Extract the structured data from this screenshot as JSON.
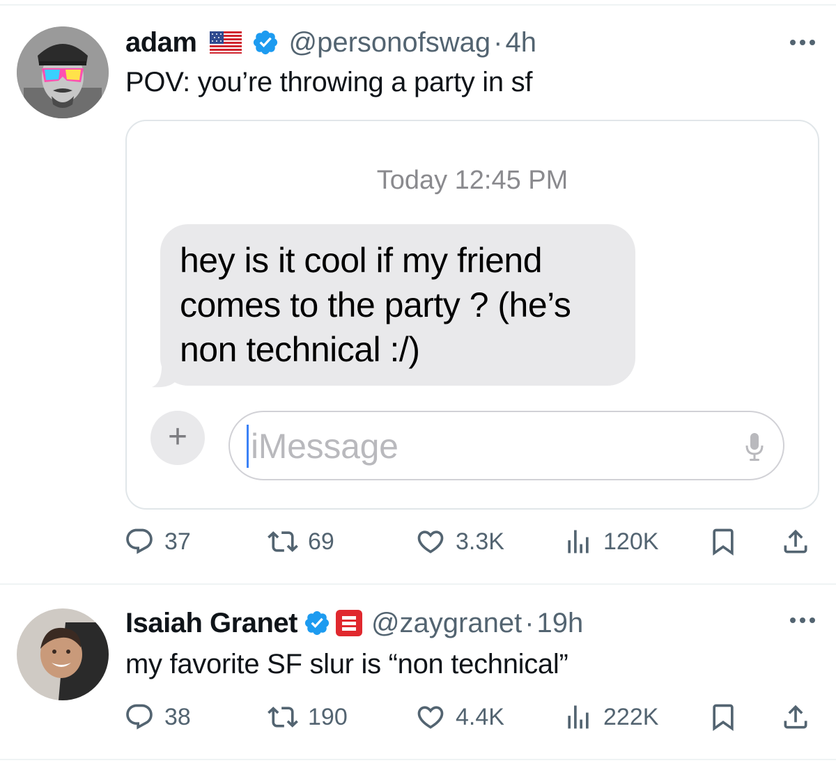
{
  "tweets": [
    {
      "display_name": "adam",
      "handle": "@personofswag",
      "separator": "·",
      "time": "4h",
      "text": "POV: you’re throwing a party in sf",
      "media": {
        "timestamp": "Today 12:45 PM",
        "bubble_text": "hey is it cool if my friend comes to the party ? (he’s non technical :/)",
        "input_placeholder": "iMessage",
        "plus_label": "+"
      },
      "stats": {
        "replies": "37",
        "retweets": "69",
        "likes": "3.3K",
        "views": "120K"
      }
    },
    {
      "display_name": "Isaiah Granet",
      "handle": "@zaygranet",
      "separator": "·",
      "time": "19h",
      "text": "my favorite SF slur is “non technical”",
      "stats": {
        "replies": "38",
        "retweets": "190",
        "likes": "4.4K",
        "views": "222K"
      }
    }
  ],
  "colors": {
    "verified_blue": "#1d9bf0",
    "secondary_text": "#536471",
    "bubble_gray": "#e9e9eb",
    "org_badge_red": "#e0282e"
  },
  "icons": {
    "reply": "speech-bubble-icon",
    "retweet": "retweet-arrows-icon",
    "like": "heart-icon",
    "views": "bar-chart-icon",
    "bookmark": "bookmark-icon",
    "share": "share-upload-icon",
    "more": "ellipsis-icon",
    "verified": "verified-badge-icon",
    "flag": "us-flag-icon",
    "mic": "microphone-icon"
  }
}
